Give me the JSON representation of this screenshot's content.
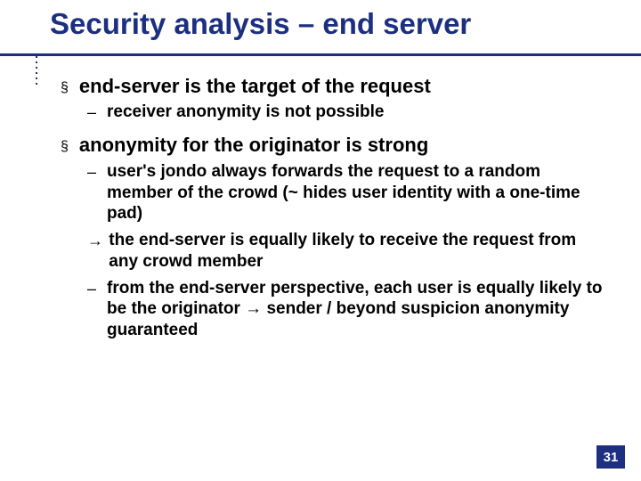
{
  "title": "Security analysis – end server",
  "bullets": {
    "b1": {
      "marker": "§",
      "text": "end-server is the target of the request"
    },
    "b1_1": {
      "marker": "–",
      "text": "receiver anonymity is not possible"
    },
    "b2": {
      "marker": "§",
      "text": "anonymity for the originator is strong"
    },
    "b2_1": {
      "marker": "–",
      "text": "user's jondo always forwards the request to a random member of the crowd (~ hides user identity with a one-time pad)"
    },
    "b2_2": {
      "marker": "→",
      "text": "the end-server is equally likely to receive the request from any crowd member"
    },
    "b2_3": {
      "marker": "–",
      "text": "from the end-server perspective, each user is equally likely to be the originator → sender / beyond suspicion anonymity guaranteed"
    }
  },
  "page_number": "31"
}
